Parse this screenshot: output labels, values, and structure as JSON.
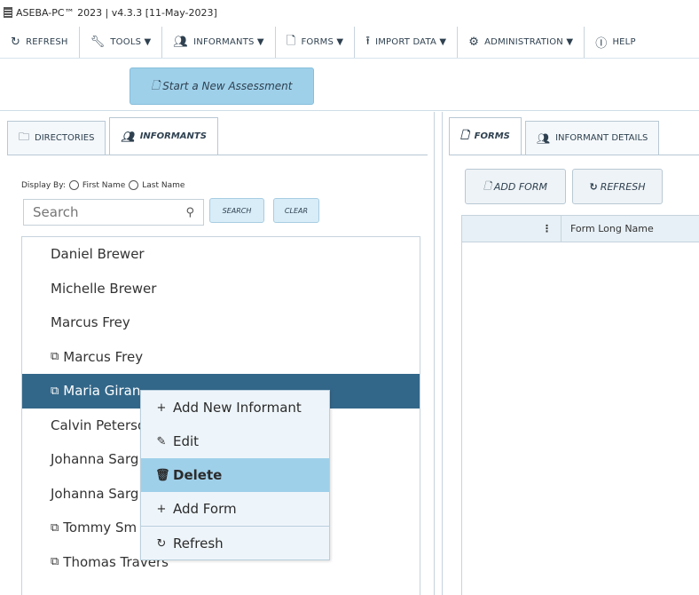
{
  "window": {
    "title": "ASEBA-PC™ 2023 | v4.3.3 [11-May-2023]"
  },
  "toolbar": {
    "items": [
      {
        "label": "Refresh",
        "icon": "refresh-icon"
      },
      {
        "label": "Tools ▼",
        "icon": "wrench-icon"
      },
      {
        "label": "Informants ▼",
        "icon": "people-icon"
      },
      {
        "label": "Forms ▼",
        "icon": "document-icon"
      },
      {
        "label": "Import Data ▼",
        "icon": "upload-icon"
      },
      {
        "label": "Administration ▼",
        "icon": "gear-icon"
      },
      {
        "label": "Help",
        "icon": "help-icon"
      }
    ]
  },
  "start_assessment": {
    "label": "Start a New Assessment"
  },
  "left_tabs": [
    {
      "label": "Directories",
      "icon": "folder-icon",
      "active": false
    },
    {
      "label": "Informants",
      "icon": "people-icon",
      "active": true
    }
  ],
  "display_by": {
    "label": "Display By:",
    "option1": "First Name",
    "option2": "Last Name"
  },
  "search": {
    "placeholder": "Search",
    "search_label": "Search",
    "clear_label": "Clear"
  },
  "informants": [
    {
      "name": "Daniel Brewer",
      "linked": false
    },
    {
      "name": "Michelle Brewer",
      "linked": false
    },
    {
      "name": "Marcus Frey",
      "linked": false
    },
    {
      "name": "Marcus Frey",
      "linked": true
    },
    {
      "name": "Maria Giran",
      "linked": true,
      "selected": true
    },
    {
      "name": "Calvin Peterso",
      "linked": false
    },
    {
      "name": "Johanna Sarg",
      "linked": false
    },
    {
      "name": "Johanna Sarg",
      "linked": false
    },
    {
      "name": "Tommy Sm",
      "linked": true
    },
    {
      "name": "Thomas Travers",
      "linked": true
    }
  ],
  "context_menu": [
    {
      "label": "Add New Informant",
      "icon": "plus-icon"
    },
    {
      "label": "Edit",
      "icon": "pencil-icon"
    },
    {
      "label": "Delete",
      "icon": "trash-icon",
      "highlighted": true
    },
    {
      "label": "Add Form",
      "icon": "plus-icon"
    },
    {
      "label": "Refresh",
      "icon": "refresh-icon"
    }
  ],
  "right_tabs": [
    {
      "label": "Forms",
      "icon": "document-icon",
      "active": true
    },
    {
      "label": "Informant Details",
      "icon": "people-icon",
      "active": false
    }
  ],
  "right_buttons": {
    "add_form": "Add Form",
    "refresh": "Refresh"
  },
  "forms_grid": {
    "kebab": "⋮",
    "column": "Form Long Name"
  },
  "colors": {
    "selected_row": "#336789",
    "accent": "#9fd0ea",
    "menu_bg": "#eef5fa"
  }
}
